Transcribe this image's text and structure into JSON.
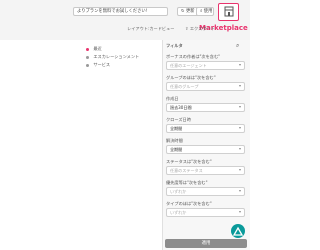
{
  "header": {
    "plan_button": "よりプランを無料でお試しください!",
    "update_button": "更新",
    "help_button": "使用"
  },
  "toolbar": {
    "layout_link": "レイアウト:カードビュー",
    "export_link": "エクスポート"
  },
  "marketplace": {
    "label": "Marketplace"
  },
  "left_list": [
    {
      "label": "最近",
      "color": "#e8336d"
    },
    {
      "label": "エスカレーションメント",
      "color": "#999999"
    },
    {
      "label": "サービス",
      "color": "#999999"
    }
  ],
  "filter_panel": {
    "title": "フィルタ",
    "fields": [
      {
        "label": "ボーナスの作者は\"次を含む\"",
        "value": "任意のエージェント",
        "filled": false
      },
      {
        "label": "グループのほは\"次を含む\"",
        "value": "任意のグループ",
        "filled": false
      },
      {
        "label": "作成日",
        "value": "過去30日間",
        "filled": true
      },
      {
        "label": "クローズ日時",
        "value": "全期間",
        "filled": true
      },
      {
        "label": "解決時間",
        "value": "全期間",
        "filled": true
      },
      {
        "label": "ステータスは\"次を含む\"",
        "value": "任意のステータス",
        "filled": false
      },
      {
        "label": "優先度等は\"次を含む\"",
        "value": "いずれか",
        "filled": false
      },
      {
        "label": "タイプのほは\"次を含む\"",
        "value": "いずれか",
        "filled": false
      }
    ],
    "apply_button": "適用"
  }
}
